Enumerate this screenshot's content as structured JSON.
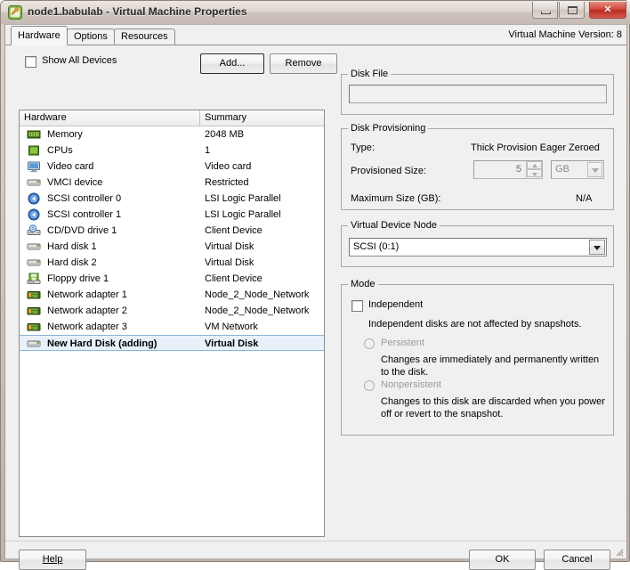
{
  "window": {
    "title": "node1.babulab - Virtual Machine Properties",
    "app_icon": "vmware-vm-icon",
    "minimize_label": "Minimize",
    "maximize_label": "Maximize",
    "close_label": "Close"
  },
  "tabs": [
    {
      "label": "Hardware",
      "active": true
    },
    {
      "label": "Options",
      "active": false
    },
    {
      "label": "Resources",
      "active": false
    }
  ],
  "version_text": "Virtual Machine Version: 8",
  "toolbar": {
    "show_all_devices_label": "Show All Devices",
    "show_all_devices_checked": false,
    "add_label": "Add...",
    "remove_label": "Remove"
  },
  "hardware_list": {
    "columns": [
      "Hardware",
      "Summary"
    ],
    "rows": [
      {
        "icon": "memory-icon",
        "name": "Memory",
        "summary": "2048 MB",
        "selected": false
      },
      {
        "icon": "cpu-icon",
        "name": "CPUs",
        "summary": "1",
        "selected": false
      },
      {
        "icon": "video-card-icon",
        "name": "Video card",
        "summary": "Video card",
        "selected": false
      },
      {
        "icon": "vmci-device-icon",
        "name": "VMCI device",
        "summary": "Restricted",
        "selected": false
      },
      {
        "icon": "scsi-controller-icon",
        "name": "SCSI controller 0",
        "summary": "LSI Logic Parallel",
        "selected": false
      },
      {
        "icon": "scsi-controller-icon",
        "name": "SCSI controller 1",
        "summary": "LSI Logic Parallel",
        "selected": false
      },
      {
        "icon": "cd-dvd-drive-icon",
        "name": "CD/DVD drive 1",
        "summary": "Client Device",
        "selected": false
      },
      {
        "icon": "hard-disk-icon",
        "name": "Hard disk 1",
        "summary": "Virtual Disk",
        "selected": false
      },
      {
        "icon": "hard-disk-icon",
        "name": "Hard disk 2",
        "summary": "Virtual Disk",
        "selected": false
      },
      {
        "icon": "floppy-drive-icon",
        "name": "Floppy drive 1",
        "summary": "Client Device",
        "selected": false
      },
      {
        "icon": "network-adapter-icon",
        "name": "Network adapter 1",
        "summary": "Node_2_Node_Network",
        "selected": false
      },
      {
        "icon": "network-adapter-icon",
        "name": "Network adapter 2",
        "summary": "Node_2_Node_Network",
        "selected": false
      },
      {
        "icon": "network-adapter-icon",
        "name": "Network adapter 3",
        "summary": "VM Network",
        "selected": false
      },
      {
        "icon": "hard-disk-icon",
        "name": "New Hard Disk (adding)",
        "summary": "Virtual Disk",
        "selected": true
      }
    ]
  },
  "disk_file": {
    "group_title": "Disk File",
    "value": ""
  },
  "disk_provisioning": {
    "group_title": "Disk Provisioning",
    "type_label": "Type:",
    "type_value": "Thick Provision Eager Zeroed",
    "provisioned_size_label": "Provisioned Size:",
    "provisioned_size_value": "5",
    "provisioned_size_unit": "GB",
    "maximum_size_label": "Maximum Size (GB):",
    "maximum_size_value": "N/A"
  },
  "virtual_device_node": {
    "group_title": "Virtual Device Node",
    "selected": "SCSI (0:1)"
  },
  "mode": {
    "group_title": "Mode",
    "independent_label": "Independent",
    "independent_checked": false,
    "independent_desc": "Independent disks are not affected by snapshots.",
    "persistent_label": "Persistent",
    "persistent_desc": "Changes are immediately and permanently written to the disk.",
    "nonpersistent_label": "Nonpersistent",
    "nonpersistent_desc": "Changes to this disk are discarded when you power off or revert to the snapshot."
  },
  "footer": {
    "help_label": "Help",
    "ok_label": "OK",
    "cancel_label": "Cancel"
  },
  "colors": {
    "selection_bg": "#e8f1fa",
    "selection_border": "#8ab3d8",
    "dialog_bg": "#f0f0f0",
    "close_button": "#d2453a"
  }
}
